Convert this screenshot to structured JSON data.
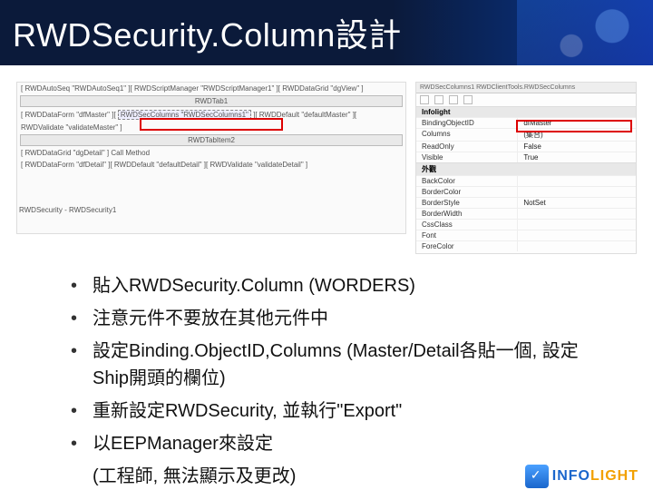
{
  "header": {
    "title": "RWDSecurity.Column設計"
  },
  "design": {
    "row1": "[ RWDAutoSeq \"RWDAutoSeq1\" ][ RWDScriptManager \"RWDScriptManager1\" ][ RWDDataGrid \"dgView\" ]",
    "tab1": "RWDTab1",
    "row2_left": "[ RWDDataForm \"dfMaster\" ][",
    "row2_sel": "RWDSecColumns \"RWDSecColumns1\"",
    "row2_right": "][ RWDDefault \"defaultMaster\" ][",
    "row3": "RWDValidate \"validateMaster\" ]",
    "tab2": "RWDTabItem2",
    "row4": "[ RWDDataGrid \"dgDetail\" ]   Call Method",
    "row5": "[ RWDDataForm \"dfDetail\" ][ RWDDefault \"defaultDetail\" ][ RWDValidate \"validateDetail\" ]",
    "node": "RWDSecurity - RWDSecurity1"
  },
  "props": {
    "header": "RWDSecColumns1  RWDClientTools.RWDSecColumns",
    "cat1": "Infolight",
    "rows1": [
      {
        "k": "BindingObjectID",
        "v": "dfMaster"
      },
      {
        "k": "Columns",
        "v": "(集合)"
      },
      {
        "k": "ReadOnly",
        "v": "False"
      },
      {
        "k": "Visible",
        "v": "True"
      }
    ],
    "cat2": "外觀",
    "rows2": [
      {
        "k": "BackColor",
        "v": ""
      },
      {
        "k": "BorderColor",
        "v": ""
      },
      {
        "k": "BorderStyle",
        "v": "NotSet"
      },
      {
        "k": "BorderWidth",
        "v": ""
      },
      {
        "k": "CssClass",
        "v": ""
      },
      {
        "k": "Font",
        "v": ""
      },
      {
        "k": "ForeColor",
        "v": ""
      }
    ]
  },
  "bullets": [
    "貼入RWDSecurity.Column (WORDERS)",
    "注意元件不要放在其他元件中",
    "設定Binding.ObjectID,Columns (Master/Detail各貼一個, 設定Ship開頭的欄位)",
    "重新設定RWDSecurity, 並執行\"Export\"",
    "以EEPManager來設定"
  ],
  "tail": "(工程師, 無法顯示及更改)",
  "logo": {
    "brand_a": "INFO",
    "brand_b": "LIGHT"
  }
}
